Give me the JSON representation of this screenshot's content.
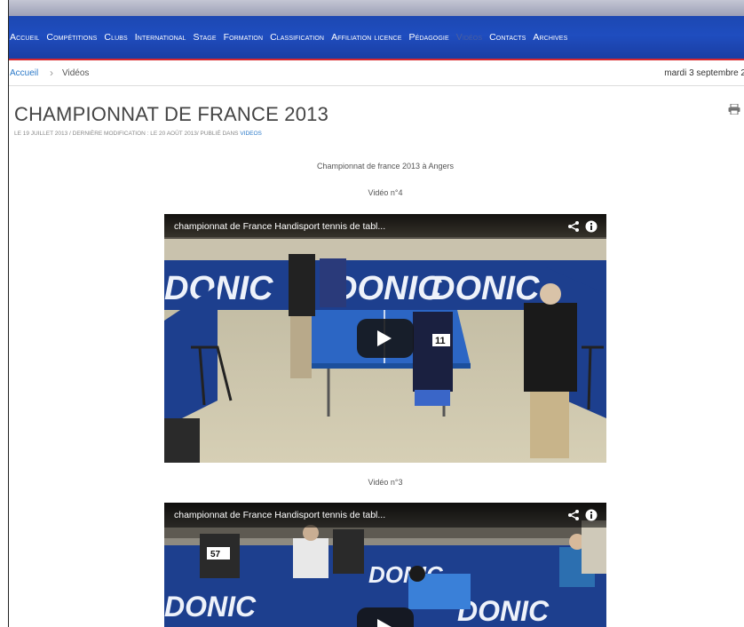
{
  "nav": {
    "items": [
      "Accueil",
      "Compétitions",
      "Clubs",
      "International",
      "Stage",
      "Formation",
      "Classification",
      "Affiliation licence",
      "Pédagogie",
      "Vidéos",
      "Contacts",
      "Archives"
    ],
    "active_index": 9
  },
  "breadcrumb": {
    "home": "Accueil",
    "separator": "›",
    "current": "Vidéos"
  },
  "date": "mardi 3 septembre 2",
  "article": {
    "title": "CHAMPIONNAT DE FRANCE 2013",
    "meta_prefix": "LE 19 JUILLET 2013 / DERNIÈRE MODIFICATION : LE 20 AOÛT 2013/ PUBLIÉ DANS",
    "meta_category": "VIDEOS",
    "intro": "Championnat de france 2013 à Angers"
  },
  "videos": [
    {
      "label": "Vidéo n°4",
      "title": "championnat de France Handisport tennis de tabl...",
      "banner": "DONIC",
      "bib": "11"
    },
    {
      "label": "Vidéo n°3",
      "title": "championnat de France Handisport tennis de tabl...",
      "banner": "DONIC",
      "bib": "57"
    }
  ],
  "colors": {
    "nav_blue": "#1f4dbf",
    "nav_red": "#d8282e",
    "link_blue": "#2b79c8",
    "donic_blue": "#1d3f8e"
  },
  "icons": [
    "print-icon",
    "share-icon",
    "info-icon",
    "play-icon"
  ]
}
